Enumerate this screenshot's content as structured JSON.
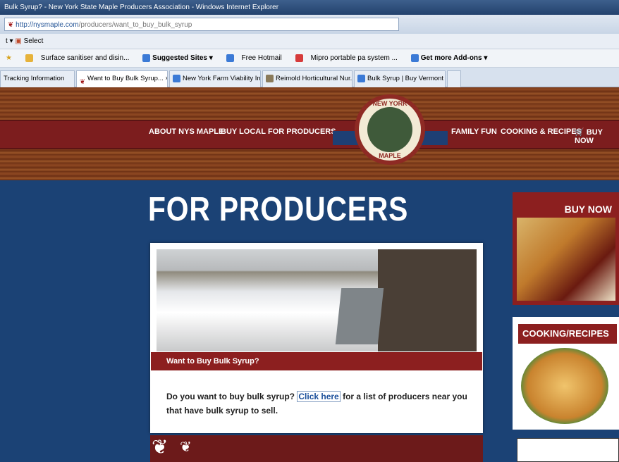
{
  "browser": {
    "window_title": "Bulk Syrup? - New York State Maple Producers Association - Windows Internet Explorer",
    "url_domain": "http://nysmaple.com",
    "url_path": "/producers/want_to_buy_bulk_syrup",
    "menu_select": "Select",
    "favorites": [
      "Surface sanitiser and disin...",
      "Suggested Sites ▾",
      "Free Hotmail",
      "Mipro portable pa system ...",
      "Get more Add-ons ▾"
    ],
    "tabs": [
      "Tracking Information",
      "Want to Buy Bulk Syrup... ×",
      "New York Farm Viability In...",
      "Reimold Horticultural Nur...",
      "Bulk Syrup | Buy Vermont ..."
    ]
  },
  "site": {
    "nav_left": [
      "ABOUT NYS MAPLE",
      "BUY LOCAL",
      "FOR PRODUCERS"
    ],
    "nav_right": [
      "FAMILY FUN",
      "COOKING & RECIPES",
      "BUY NOW"
    ],
    "logo_top": "NEW YORK",
    "logo_bottom": "MAPLE",
    "page_title": "FOR PRODUCERS",
    "banner": "Want to Buy Bulk Syrup?",
    "body_before": "Do you want to buy bulk syrup?",
    "body_link": "Click here",
    "body_after": "for a list of producers near you that have bulk syrup to sell.",
    "sidebar_buy": "BUY NOW",
    "sidebar_recipes": "COOKING/RECIPES"
  }
}
